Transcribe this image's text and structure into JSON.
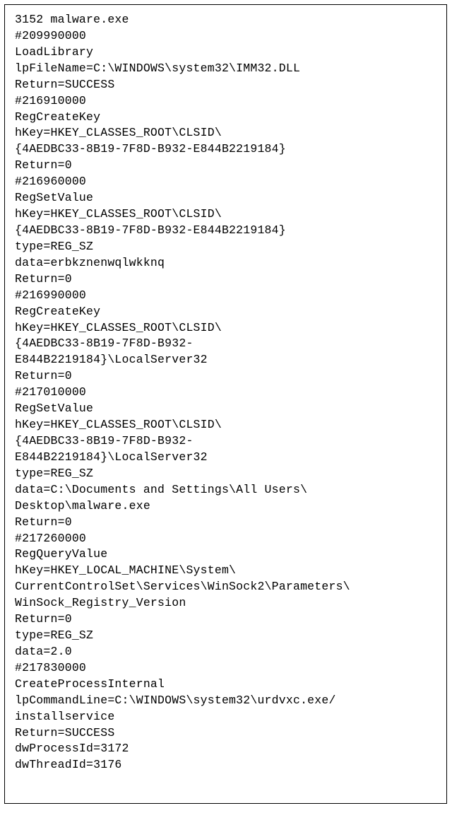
{
  "lines": [
    "3152 malware.exe",
    "#209990000",
    "LoadLibrary",
    "lpFileName=C:\\WINDOWS\\system32\\IMM32.DLL",
    "Return=SUCCESS",
    "#216910000",
    "RegCreateKey",
    "hKey=HKEY_CLASSES_ROOT\\CLSID\\",
    "{4AEDBC33-8B19-7F8D-B932-E844B2219184}",
    "Return=0",
    "#216960000",
    "RegSetValue",
    "hKey=HKEY_CLASSES_ROOT\\CLSID\\",
    "{4AEDBC33-8B19-7F8D-B932-E844B2219184}",
    "type=REG_SZ",
    "data=erbkznenwqlwkknq",
    "Return=0",
    "#216990000",
    "RegCreateKey",
    "hKey=HKEY_CLASSES_ROOT\\CLSID\\",
    "{4AEDBC33-8B19-7F8D-B932-",
    "E844B2219184}\\LocalServer32",
    "Return=0",
    "#217010000",
    "RegSetValue",
    "hKey=HKEY_CLASSES_ROOT\\CLSID\\",
    "{4AEDBC33-8B19-7F8D-B932-",
    "E844B2219184}\\LocalServer32",
    "type=REG_SZ",
    "data=C:\\Documents and Settings\\All Users\\",
    "Desktop\\malware.exe",
    "Return=0",
    "#217260000",
    "RegQueryValue",
    "hKey=HKEY_LOCAL_MACHINE\\System\\",
    "CurrentControlSet\\Services\\WinSock2\\Parameters\\",
    "WinSock_Registry_Version",
    "Return=0",
    "type=REG_SZ",
    "data=2.0",
    "#217830000",
    "CreateProcessInternal",
    "lpCommandLine=C:\\WINDOWS\\system32\\urdvxc.exe/",
    "installservice",
    "Return=SUCCESS",
    "dwProcessId=3172",
    "dwThreadId=3176"
  ]
}
